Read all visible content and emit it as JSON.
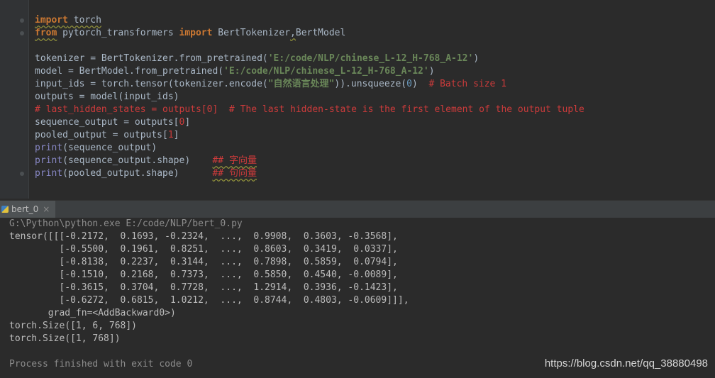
{
  "editor": {
    "lines": [
      [
        {
          "t": "import",
          "c": "kw-u"
        },
        {
          "t": " torch",
          "c": "uq"
        }
      ],
      [
        {
          "t": "from",
          "c": "kw-u"
        },
        {
          "t": " pytorch_transformers ",
          "c": ""
        },
        {
          "t": "import",
          "c": "kw"
        },
        {
          "t": " BertTokenizer",
          "c": ""
        },
        {
          "t": ",",
          "c": "uq"
        },
        {
          "t": "BertModel",
          "c": ""
        }
      ],
      [
        {
          "t": "",
          "c": ""
        }
      ],
      [
        {
          "t": "tokenizer = BertTokenizer.from_pretrained(",
          "c": ""
        },
        {
          "t": "'E:/code/NLP/chinese_L-12_H-768_A-12'",
          "c": "str"
        },
        {
          "t": ")",
          "c": ""
        }
      ],
      [
        {
          "t": "model = BertModel.from_pretrained(",
          "c": ""
        },
        {
          "t": "'E:/code/NLP/chinese_L-12_H-768_A-12'",
          "c": "str"
        },
        {
          "t": ")",
          "c": ""
        }
      ],
      [
        {
          "t": "input_ids = torch.tensor(tokenizer.encode(",
          "c": ""
        },
        {
          "t": "\"自然语言处理\"",
          "c": "str"
        },
        {
          "t": ")).unsqueeze(",
          "c": ""
        },
        {
          "t": "0",
          "c": "num"
        },
        {
          "t": ")  ",
          "c": ""
        },
        {
          "t": "# Batch size 1",
          "c": "cmt"
        }
      ],
      [
        {
          "t": "outputs = model(input_ids)",
          "c": ""
        }
      ],
      [
        {
          "t": "# last_hidden_states = outputs[0]  # The last hidden-state is the first element of the output tuple",
          "c": "cmt"
        }
      ],
      [
        {
          "t": "sequence_output = outputs[",
          "c": ""
        },
        {
          "t": "0",
          "c": "idx"
        },
        {
          "t": "]",
          "c": ""
        }
      ],
      [
        {
          "t": "pooled_output = outputs[",
          "c": ""
        },
        {
          "t": "1",
          "c": "idx"
        },
        {
          "t": "]",
          "c": ""
        }
      ],
      [
        {
          "t": "print",
          "c": "fn"
        },
        {
          "t": "(sequence_output)",
          "c": ""
        }
      ],
      [
        {
          "t": "print",
          "c": "fn"
        },
        {
          "t": "(sequence_output.shape)    ",
          "c": ""
        },
        {
          "t": "## 字向量",
          "c": "cmt uq"
        }
      ],
      [
        {
          "t": "print",
          "c": "fn"
        },
        {
          "t": "(pooled_output.shape)      ",
          "c": ""
        },
        {
          "t": "## 句向量",
          "c": "cmt uq"
        }
      ]
    ]
  },
  "run": {
    "tab_label": "bert_0",
    "close_glyph": "×",
    "output_lines": [
      {
        "t": "G:\\Python\\python.exe E:/code/NLP/bert_0.py",
        "c": "gray"
      },
      {
        "t": "tensor([[[-0.2172,  0.1693, -0.2324,  ...,  0.9908,  0.3603, -0.3568],",
        "c": ""
      },
      {
        "t": "         [-0.5500,  0.1961,  0.8251,  ...,  0.8603,  0.3419,  0.0337],",
        "c": ""
      },
      {
        "t": "         [-0.8138,  0.2237,  0.3144,  ...,  0.7898,  0.5859,  0.0794],",
        "c": ""
      },
      {
        "t": "         [-0.1510,  0.2168,  0.7373,  ...,  0.5850,  0.4540, -0.0089],",
        "c": ""
      },
      {
        "t": "         [-0.3615,  0.3704,  0.7728,  ...,  1.2914,  0.3936, -0.1423],",
        "c": ""
      },
      {
        "t": "         [-0.6272,  0.6815,  1.0212,  ...,  0.8744,  0.4803, -0.0609]]],",
        "c": ""
      },
      {
        "t": "       grad_fn=<AddBackward0>)",
        "c": ""
      },
      {
        "t": "torch.Size([1, 6, 768])",
        "c": ""
      },
      {
        "t": "torch.Size([1, 768])",
        "c": ""
      },
      {
        "t": "",
        "c": ""
      },
      {
        "t": "Process finished with exit code 0",
        "c": "gray"
      }
    ]
  },
  "watermark": "https://blog.csdn.net/qq_38880498",
  "colors": {
    "keyword": "#cc7832",
    "string": "#6a8759",
    "number": "#6897bb",
    "comment": "#cc3b3b",
    "builtin": "#8888c6",
    "background": "#2b2b2b"
  },
  "icons": [
    "python-file-icon",
    "close-icon"
  ]
}
